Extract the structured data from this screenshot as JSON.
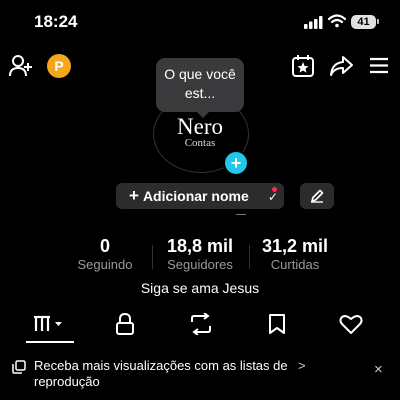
{
  "status_bar": {
    "time": "18:24",
    "battery": "41"
  },
  "header": {
    "coin_letter": "P"
  },
  "note": {
    "text": "O que você est..."
  },
  "avatar": {
    "name": "Nero",
    "subtitle": "Contas"
  },
  "add_name": {
    "label": "Adicionar nome"
  },
  "stats": [
    {
      "value": "0",
      "label": "Seguindo"
    },
    {
      "value": "18,8 mil",
      "label": "Seguidores"
    },
    {
      "value": "31,2 mil",
      "label": "Curtidas"
    }
  ],
  "bio": "Siga se ama Jesus",
  "tabs": [
    "videos-grid-icon",
    "lock-icon",
    "repost-icon",
    "bookmark-icon",
    "heart-icon"
  ],
  "banner": {
    "text": "Receba mais visualizações com as listas de reprodução",
    "arrow": ">",
    "close": "×"
  },
  "colors": {
    "accent": "#20c7e8",
    "coin": "#f3a81c",
    "notification": "#ff2d55"
  }
}
